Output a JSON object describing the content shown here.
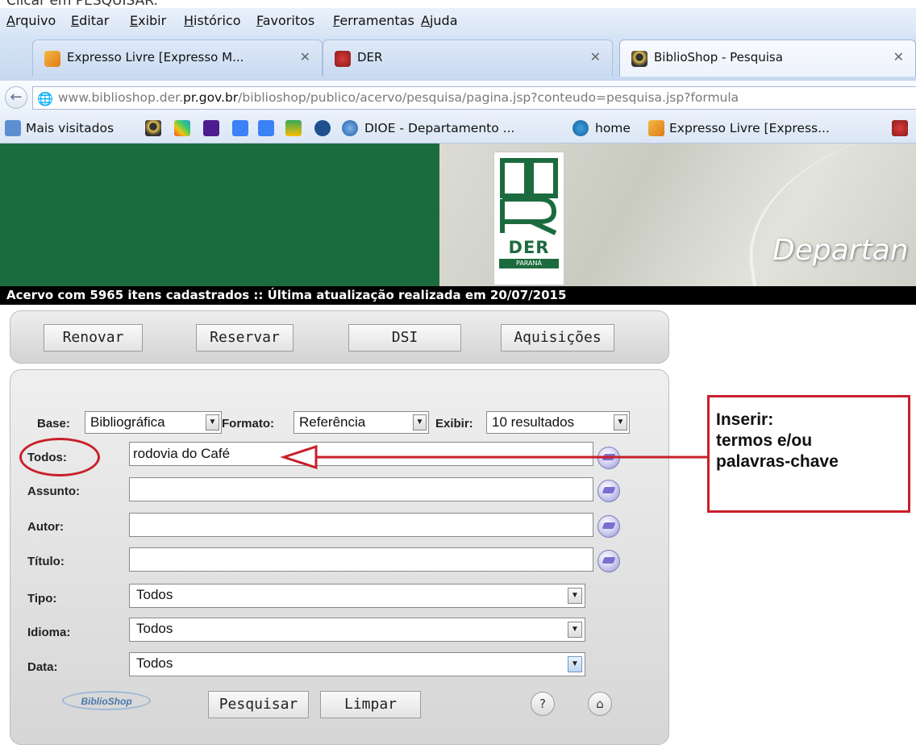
{
  "top_cut_text": "Clicar em PESQUISAR.",
  "menu": [
    "Arquivo",
    "Editar",
    "Exibir",
    "Histórico",
    "Favoritos",
    "Ferramentas",
    "Ajuda"
  ],
  "tabs": [
    {
      "title": "Expresso Livre [Expresso M...",
      "close": "✕",
      "icon": "expresso-tab-icon"
    },
    {
      "title": "DER",
      "close": "✕",
      "icon": "der-tab-icon"
    },
    {
      "title": "BiblioShop - Pesquisa",
      "close": "✕",
      "icon": "biblioshop-tab-icon"
    }
  ],
  "address": {
    "prefix": "www.biblioshop.der.",
    "domain": "pr.gov.br",
    "suffix": "/biblioshop/publico/acervo/pesquisa/pagina.jsp?conteudo=pesquisa.jsp?formula"
  },
  "bookmarks": {
    "mais_visitados": "Mais visitados",
    "dioe": "DIOE - Departamento ...",
    "home": "home",
    "expresso": "Expresso Livre [Express..."
  },
  "banner": {
    "logo_letters": "DER",
    "logo_state": "PARANÁ",
    "heading": "Departan"
  },
  "info_bar": "Acervo com 5965 itens cadastrados :: Última atualização realizada em 20/07/2015",
  "actions": {
    "renovar": "Renovar",
    "reservar": "Reservar",
    "dsi": "DSI",
    "aquisicoes": "Aquisições"
  },
  "search": {
    "base_label": "Base:",
    "base_value": "Bibliográfica",
    "formato_label": "Formato:",
    "formato_value": "Referência",
    "exibir_label": "Exibir:",
    "exibir_value": "10 resultados",
    "todos_label": "Todos:",
    "todos_value": "rodovia do Café",
    "assunto_label": "Assunto:",
    "assunto_value": "",
    "autor_label": "Autor:",
    "autor_value": "",
    "titulo_label": "Título:",
    "titulo_value": "",
    "tipo_label": "Tipo:",
    "tipo_value": "Todos",
    "idioma_label": "Idioma:",
    "idioma_value": "Todos",
    "data_label": "Data:",
    "data_value": "Todos",
    "pesquisar": "Pesquisar",
    "limpar": "Limpar",
    "help": "?",
    "home_icon": "⌂",
    "logo_text": "BiblioShop"
  },
  "annotation": {
    "line1": "Inserir:",
    "line2": "termos e/ou",
    "line3": "palavras-chave",
    "color": "#c8202a"
  }
}
